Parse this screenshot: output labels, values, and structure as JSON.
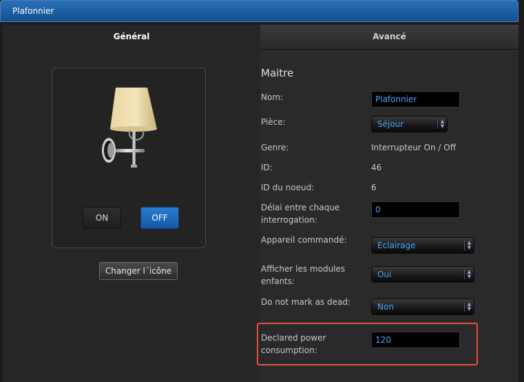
{
  "window": {
    "title": "Plafonnier"
  },
  "tabs": [
    {
      "label": "Général",
      "active": true
    },
    {
      "label": "Avancé",
      "active": false
    }
  ],
  "device": {
    "on_label": "ON",
    "off_label": "OFF",
    "state": "OFF",
    "change_icon_label": "Changer l´icône",
    "icon": "wall-lamp-icon"
  },
  "section": {
    "title": "Maitre"
  },
  "fields": {
    "nom": {
      "label": "Nom:",
      "value": "Plafonnier"
    },
    "piece": {
      "label": "Pièce:",
      "value": "Séjour"
    },
    "genre": {
      "label": "Genre:",
      "value": "Interrupteur On / Off"
    },
    "id": {
      "label": "ID:",
      "value": "46"
    },
    "id_noeud": {
      "label": "ID du noeud:",
      "value": "6"
    },
    "delai": {
      "label": "Délai entre chaque interrogation:",
      "value": "0"
    },
    "appareil": {
      "label": "Appareil commandé:",
      "value": "Eclairage"
    },
    "afficher": {
      "label": "Afficher les modules enfants:",
      "value": "Oui"
    },
    "dead": {
      "label": "Do not mark as dead:",
      "value": "Non"
    },
    "power": {
      "label": "Declared power consumption:",
      "value": "120"
    }
  },
  "colors": {
    "accent": "#2b7cd0",
    "highlight": "#e8523a",
    "value_text": "#4aa3ff"
  }
}
